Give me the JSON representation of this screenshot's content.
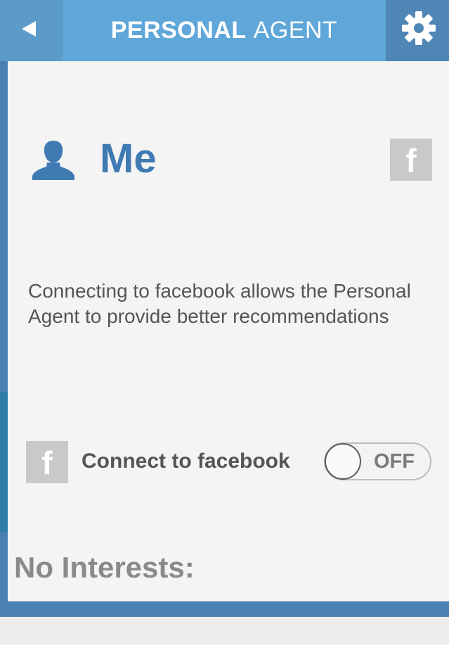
{
  "header": {
    "title_bold": "PERSONAL",
    "title_light": "AGENT",
    "back_icon": "back-arrow-icon",
    "settings_icon": "gear-icon"
  },
  "profile": {
    "name": "Me",
    "avatar_icon": "person-icon",
    "facebook_badge": "f"
  },
  "description": "Connecting to facebook allows the Personal Agent to provide better recommendations",
  "connect": {
    "badge": "f",
    "label": "Connect to facebook",
    "toggle_state": "OFF"
  },
  "interests": {
    "heading": "No Interests:"
  },
  "colors": {
    "header": "#5fa6d9",
    "back_button": "#5b9ac9",
    "settings_button": "#4f86b6",
    "accent_blue": "#3f7ab3",
    "sidebar": "#4a80b2",
    "panel": "#f4f4f4",
    "badge_gray": "#c9c9c9"
  }
}
